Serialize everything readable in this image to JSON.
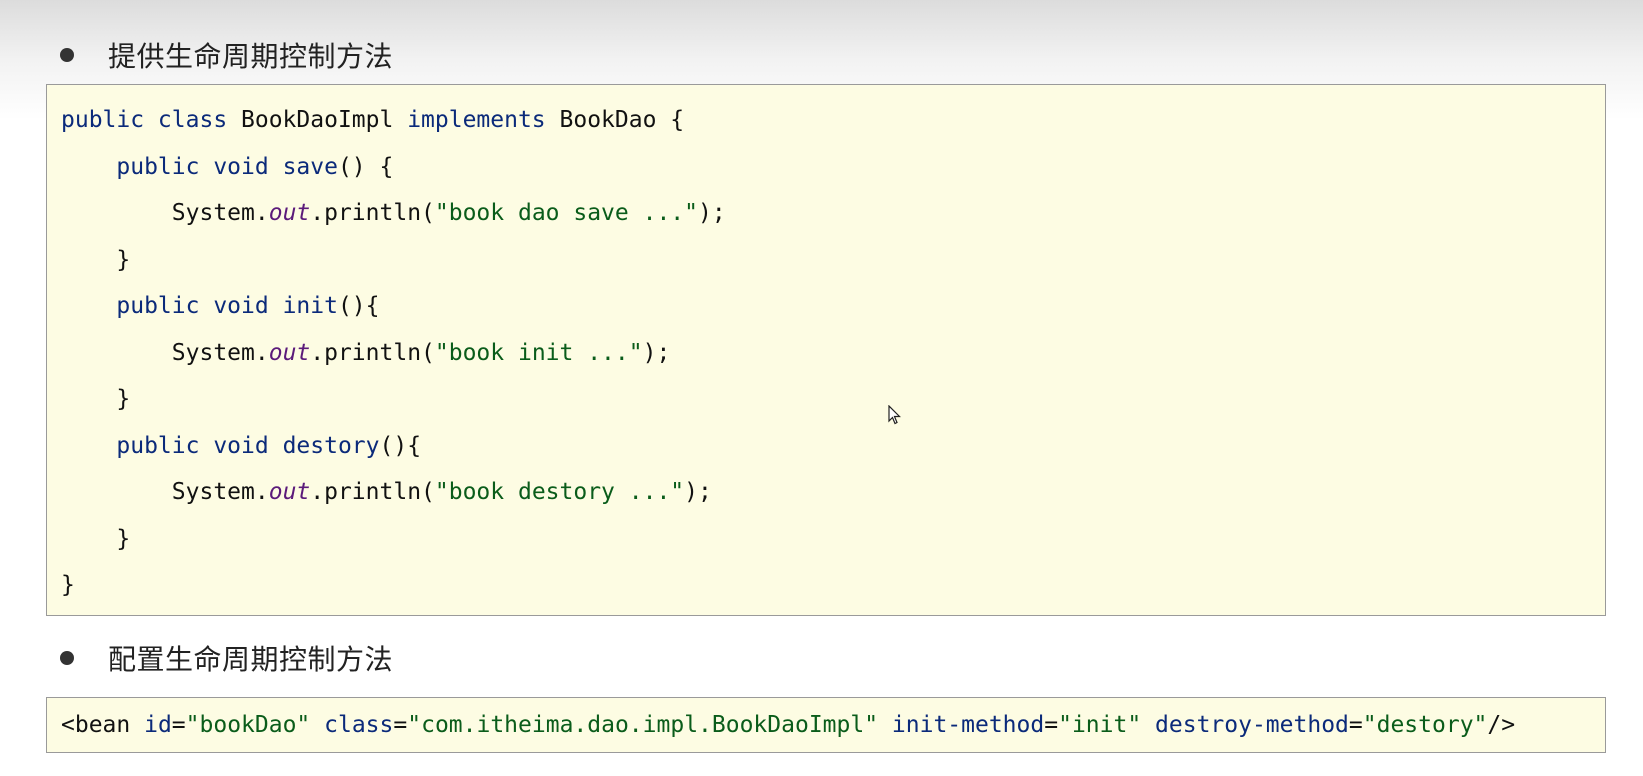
{
  "sections": [
    {
      "bullet": "提供生命周期控制方法"
    },
    {
      "bullet": "配置生命周期控制方法"
    }
  ],
  "java_code": {
    "lines": [
      [
        {
          "t": "public class ",
          "c": "kw"
        },
        {
          "t": "BookDaoImpl ",
          "c": ""
        },
        {
          "t": "implements ",
          "c": "kw"
        },
        {
          "t": "BookDao {",
          "c": ""
        }
      ],
      [
        {
          "t": "    public void ",
          "c": "kw"
        },
        {
          "t": "save",
          "c": "kw"
        },
        {
          "t": "() {",
          "c": ""
        }
      ],
      [
        {
          "t": "        System.",
          "c": ""
        },
        {
          "t": "out",
          "c": "it"
        },
        {
          "t": ".println(",
          "c": ""
        },
        {
          "t": "\"book dao save ...\"",
          "c": "str"
        },
        {
          "t": ");",
          "c": ""
        }
      ],
      [
        {
          "t": "    }",
          "c": ""
        }
      ],
      [
        {
          "t": "    public void ",
          "c": "kw"
        },
        {
          "t": "init",
          "c": "kw"
        },
        {
          "t": "(){",
          "c": ""
        }
      ],
      [
        {
          "t": "        System.",
          "c": ""
        },
        {
          "t": "out",
          "c": "it"
        },
        {
          "t": ".println(",
          "c": ""
        },
        {
          "t": "\"book init ...\"",
          "c": "str"
        },
        {
          "t": ");",
          "c": ""
        }
      ],
      [
        {
          "t": "    }",
          "c": ""
        }
      ],
      [
        {
          "t": "    public void ",
          "c": "kw"
        },
        {
          "t": "destory",
          "c": "kw"
        },
        {
          "t": "(){",
          "c": ""
        }
      ],
      [
        {
          "t": "        System.",
          "c": ""
        },
        {
          "t": "out",
          "c": "it"
        },
        {
          "t": ".println(",
          "c": ""
        },
        {
          "t": "\"book destory ...\"",
          "c": "str"
        },
        {
          "t": ");",
          "c": ""
        }
      ],
      [
        {
          "t": "    }",
          "c": ""
        }
      ],
      [
        {
          "t": "}",
          "c": ""
        }
      ]
    ]
  },
  "xml_code": {
    "tokens": [
      {
        "t": "<bean ",
        "c": ""
      },
      {
        "t": "id",
        "c": "attr"
      },
      {
        "t": "=",
        "c": ""
      },
      {
        "t": "\"bookDao\" ",
        "c": "str"
      },
      {
        "t": "class",
        "c": "attr"
      },
      {
        "t": "=",
        "c": ""
      },
      {
        "t": "\"com.itheima.dao.impl.BookDaoImpl\" ",
        "c": "str"
      },
      {
        "t": "init-method",
        "c": "attr"
      },
      {
        "t": "=",
        "c": ""
      },
      {
        "t": "\"init\" ",
        "c": "str"
      },
      {
        "t": "destroy-method",
        "c": "attr"
      },
      {
        "t": "=",
        "c": ""
      },
      {
        "t": "\"destory\"",
        "c": "str"
      },
      {
        "t": "/>",
        "c": ""
      }
    ]
  },
  "colors": {
    "code_background": "#fdfce3",
    "keyword": "#0b2a7a",
    "string": "#0a5c1a",
    "static_field": "#5b1a7a"
  },
  "icons": {
    "cursor": "mouse-pointer-icon"
  }
}
